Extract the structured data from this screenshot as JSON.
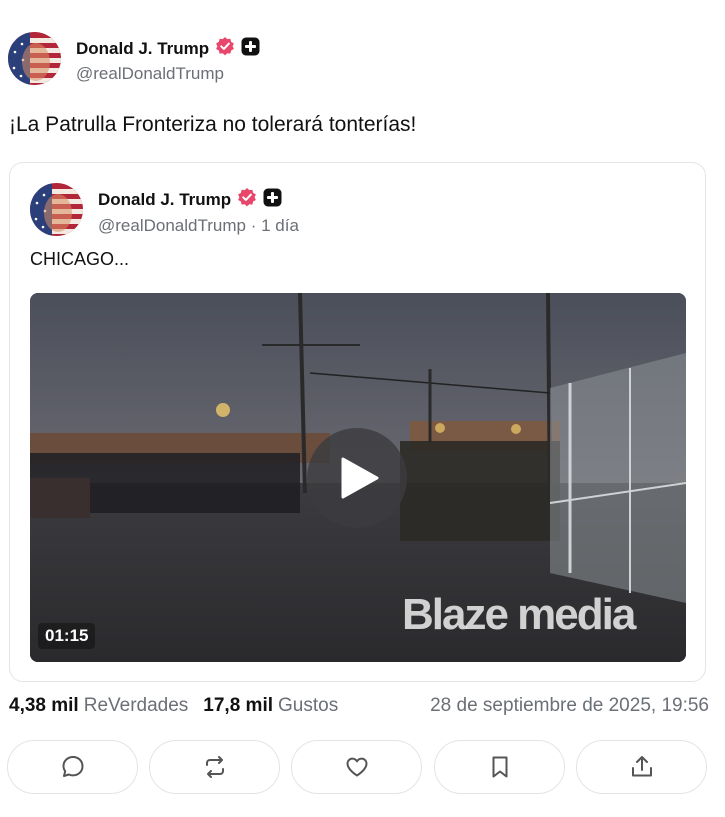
{
  "post": {
    "author_name": "Donald J. Trump",
    "author_handle": "@realDonaldTrump",
    "text": "¡La Patrulla Fronteriza no tolerará tonterías!"
  },
  "quote": {
    "author_name": "Donald J. Trump",
    "author_handle": "@realDonaldTrump",
    "separator": "·",
    "time_ago": "1 día",
    "text": "CHICAGO...",
    "video": {
      "duration": "01:15",
      "watermark": "Blaze media",
      "play_icon": "play-icon"
    }
  },
  "stats": {
    "reposts_count": "4,38 mil",
    "reposts_label": "ReVerdades",
    "likes_count": "17,8 mil",
    "likes_label": "Gustos",
    "date": "28 de septiembre de 2025, 19:56"
  },
  "actions": [
    {
      "icon": "reply-icon"
    },
    {
      "icon": "repost-icon"
    },
    {
      "icon": "like-icon"
    },
    {
      "icon": "bookmark-icon"
    },
    {
      "icon": "share-icon"
    }
  ],
  "colors": {
    "verified_badge": "#e8466a",
    "muted_text": "#6b6f76",
    "border": "#e3e4e8"
  }
}
